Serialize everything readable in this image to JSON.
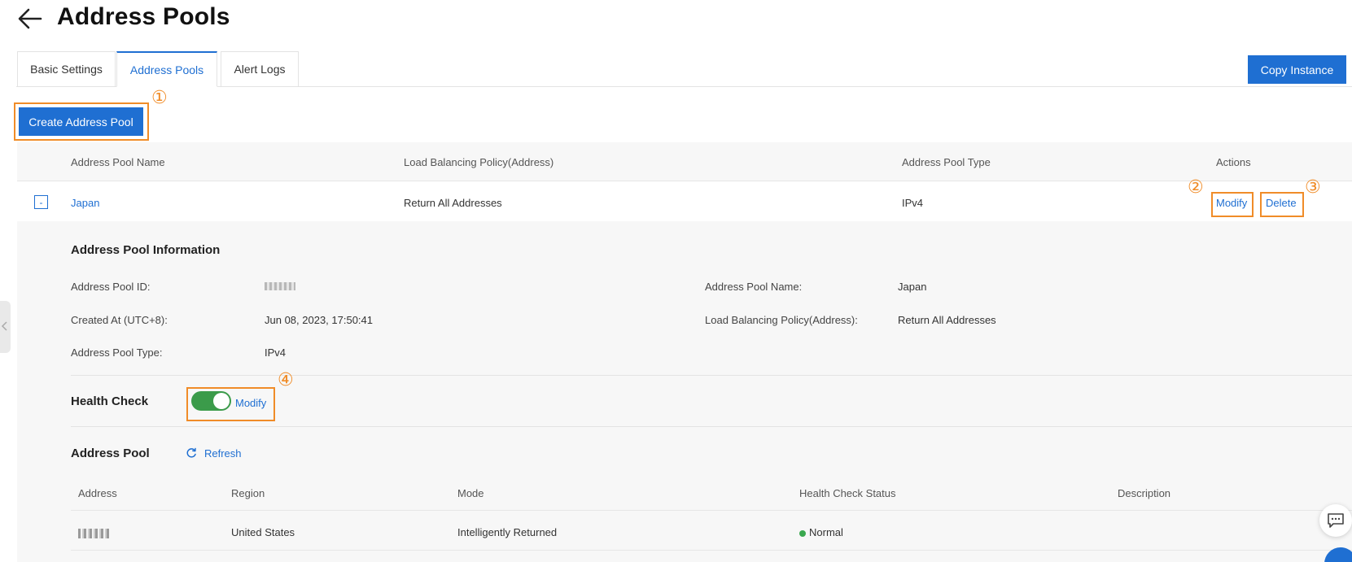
{
  "header": {
    "title": "Address Pools"
  },
  "tabs": [
    {
      "label": "Basic Settings"
    },
    {
      "label": "Address Pools"
    },
    {
      "label": "Alert Logs"
    }
  ],
  "toolbar": {
    "copy_instance_label": "Copy Instance",
    "create_pool_label": "Create Address Pool"
  },
  "annotations": [
    "①",
    "②",
    "③",
    "④"
  ],
  "table": {
    "columns": [
      "Address Pool Name",
      "Load Balancing Policy(Address)",
      "Address Pool Type",
      "Actions"
    ],
    "rows": [
      {
        "expand_symbol": "-",
        "name": "Japan",
        "policy": "Return All Addresses",
        "type": "IPv4",
        "actions": {
          "modify": "Modify",
          "delete": "Delete"
        }
      }
    ]
  },
  "details": {
    "title": "Address Pool Information",
    "fields": {
      "id_label": "Address Pool ID:",
      "created_label": "Created At (UTC+8):",
      "created_value": "Jun 08, 2023, 17:50:41",
      "type_label": "Address Pool Type:",
      "type_value": "IPv4",
      "name_label": "Address Pool Name:",
      "name_value": "Japan",
      "policy_label": "Load Balancing Policy(Address):",
      "policy_value": "Return All Addresses"
    }
  },
  "health_check": {
    "title": "Health Check",
    "enabled": true,
    "modify_label": "Modify"
  },
  "address_pool": {
    "title": "Address Pool",
    "refresh_label": "Refresh",
    "columns": [
      "Address",
      "Region",
      "Mode",
      "Health Check Status",
      "Description"
    ],
    "rows": [
      {
        "region": "United States",
        "mode": "Intelligently Returned",
        "status": "Normal",
        "description": ""
      }
    ]
  },
  "colors": {
    "primary": "#1f6fd2",
    "highlight": "#f08c28",
    "switch_on": "#3b9b4a",
    "status_normal": "#3aa84f"
  },
  "icons": [
    "back-arrow-icon",
    "refresh-icon",
    "chat-icon",
    "chevron-left-icon"
  ]
}
